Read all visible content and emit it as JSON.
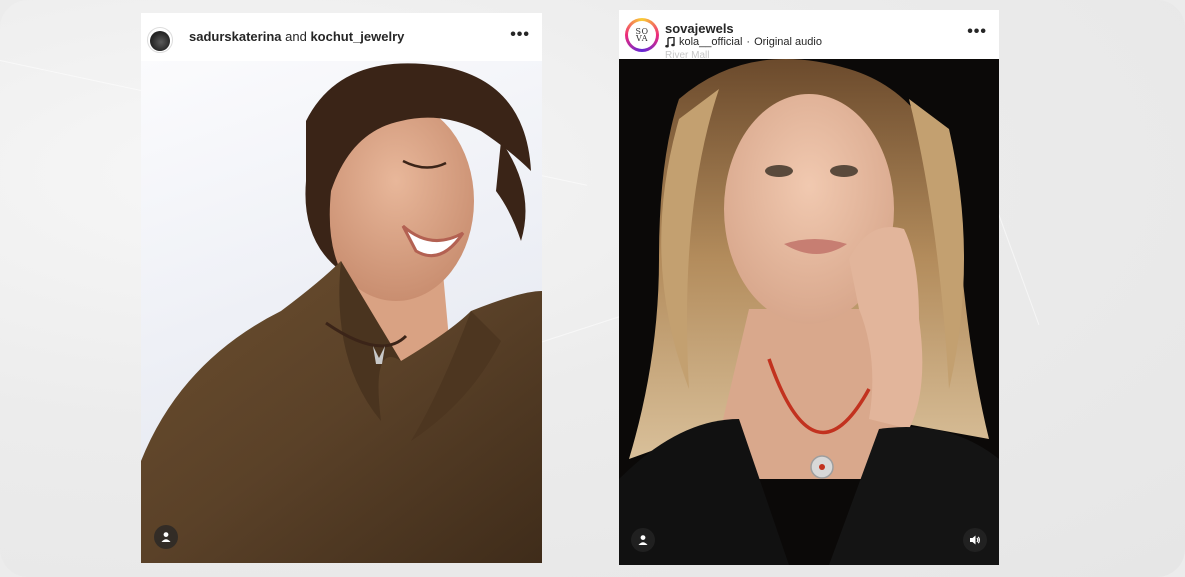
{
  "post1": {
    "user_a": "sadurskaterina",
    "connector": "and",
    "user_b": "kochut_jewelry",
    "more_label": "•••",
    "icons": {
      "avatar": "avatar-photo",
      "more": "more-options-icon",
      "tag": "user-tag-icon"
    }
  },
  "post2": {
    "username": "sovajewels",
    "avatar_text_top": "SO",
    "avatar_text_bottom": "VA",
    "audio_artist": "kola__official",
    "audio_sep": "·",
    "audio_title": "Original audio",
    "location": "River Mall",
    "more_label": "•••",
    "icons": {
      "music": "music-note-icon",
      "more": "more-options-icon",
      "tag": "user-tag-icon",
      "sound": "speaker-icon"
    }
  },
  "colors": {
    "background": "#ececec",
    "text": "#262626",
    "coat": "#5e4428",
    "cord": "#c2321f"
  }
}
